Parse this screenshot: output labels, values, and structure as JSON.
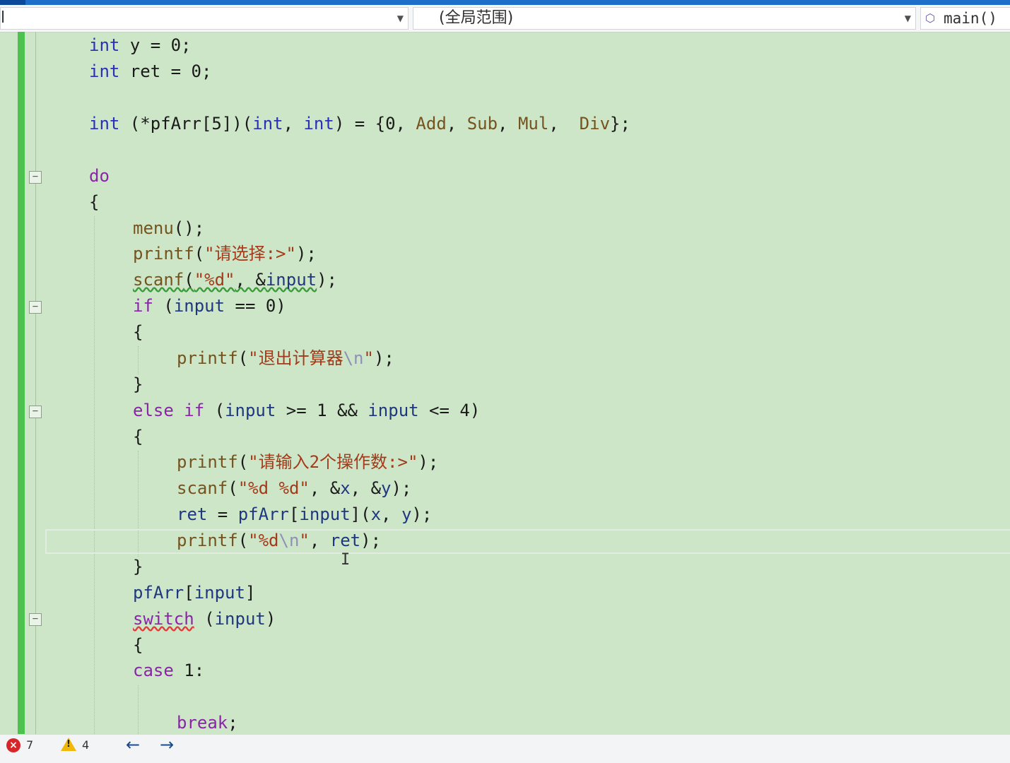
{
  "navbar": {
    "project": "l",
    "scope": "(全局范围)",
    "function": "main()"
  },
  "code": {
    "l01": {
      "kw": "int",
      "rest": " y = 0;"
    },
    "l02": {
      "kw": "int",
      "rest": " ret = 0;"
    },
    "l03": {
      "kw1": "int",
      "p1": " (*pfArr[5])(",
      "kw2": "int",
      "p2": ", ",
      "kw3": "int",
      "p3": ") = {0, ",
      "f1": "Add",
      "c1": ", ",
      "f2": "Sub",
      "c2": ", ",
      "f3": "Mul",
      "c3": ",  ",
      "f4": "Div",
      "end": "};"
    },
    "l04": {
      "kw": "do"
    },
    "l05": {
      "t": "{"
    },
    "l06": {
      "fn": "menu",
      "rest": "();"
    },
    "l07": {
      "fn": "printf",
      "p": "(",
      "s": "\"请选择:>\"",
      "end": ");"
    },
    "l08": {
      "fn": "scanf",
      "p": "(",
      "s": "\"%d\"",
      "m": ", &",
      "v": "input",
      "end": ");"
    },
    "l09": {
      "kw": "if",
      "p": " (",
      "v": "input",
      "end": " == 0)"
    },
    "l10": {
      "t": "{"
    },
    "l11": {
      "fn": "printf",
      "p": "(",
      "s1": "\"退出计算器",
      "esc": "\\n",
      "s2": "\"",
      "end": ");"
    },
    "l12": {
      "t": "}"
    },
    "l13": {
      "kw1": "else",
      "sp": " ",
      "kw2": "if",
      "p": " (",
      "v1": "input",
      "m": " >= 1 && ",
      "v2": "input",
      "end": " <= 4)"
    },
    "l14": {
      "t": "{"
    },
    "l15": {
      "fn": "printf",
      "p": "(",
      "s": "\"请输入2个操作数:>\"",
      "end": ");"
    },
    "l16": {
      "fn": "scanf",
      "p": "(",
      "s": "\"%d %d\"",
      "m1": ", &",
      "v1": "x",
      "m2": ", &",
      "v2": "y",
      "end": ");"
    },
    "l17": {
      "v1": "ret",
      "m1": " = ",
      "v2": "pfArr",
      "m2": "[",
      "v3": "input",
      "m3": "](",
      "v4": "x",
      "m4": ", ",
      "v5": "y",
      "end": ");"
    },
    "l18": {
      "fn": "printf",
      "p": "(",
      "s1": "\"%d",
      "esc": "\\n",
      "s2": "\"",
      "m": ", ",
      "v": "ret",
      "end": ");"
    },
    "l19": {
      "t": "}"
    },
    "l20": {
      "v1": "pfArr",
      "m": "[",
      "v2": "input",
      "end": "]"
    },
    "l21": {
      "kw": "switch",
      "p": " (",
      "v": "input",
      "end": ")"
    },
    "l22": {
      "t": "{"
    },
    "l23": {
      "kw": "case",
      "end": " 1:"
    },
    "l24": {
      "kw": "break",
      "end": ";"
    }
  },
  "status": {
    "errors": "7",
    "warnings": "4",
    "warning_mark": "!",
    "error_mark": "×",
    "back": "←",
    "forward": "→"
  }
}
